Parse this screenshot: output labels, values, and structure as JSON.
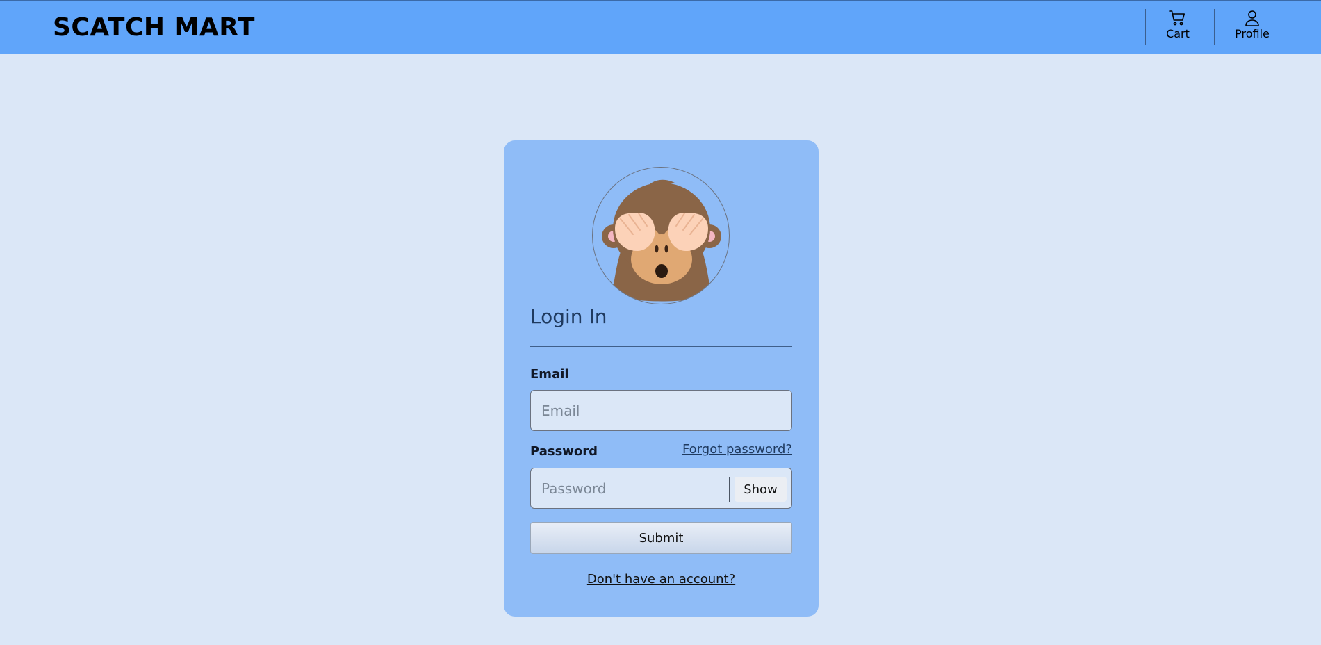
{
  "header": {
    "brand": "SCATCH MART",
    "nav": [
      {
        "label": "Cart",
        "icon": "cart-icon"
      },
      {
        "label": "Profile",
        "icon": "user-icon"
      }
    ]
  },
  "login": {
    "avatar_icon": "monkey-covering-eyes-icon",
    "title": "Login In",
    "email_label": "Email",
    "email_placeholder": "Email",
    "email_value": "",
    "password_label": "Password",
    "forgot_label": "Forgot password?",
    "password_placeholder": "Password",
    "password_value": "",
    "show_label": "Show",
    "submit_label": "Submit",
    "signup_link": "Don't have an account?"
  },
  "colors": {
    "page_bg": "#dbe7f7",
    "header_bg": "#60a5fa",
    "card_bg": "#8fbcf7",
    "title_color": "#1f3a5f"
  }
}
